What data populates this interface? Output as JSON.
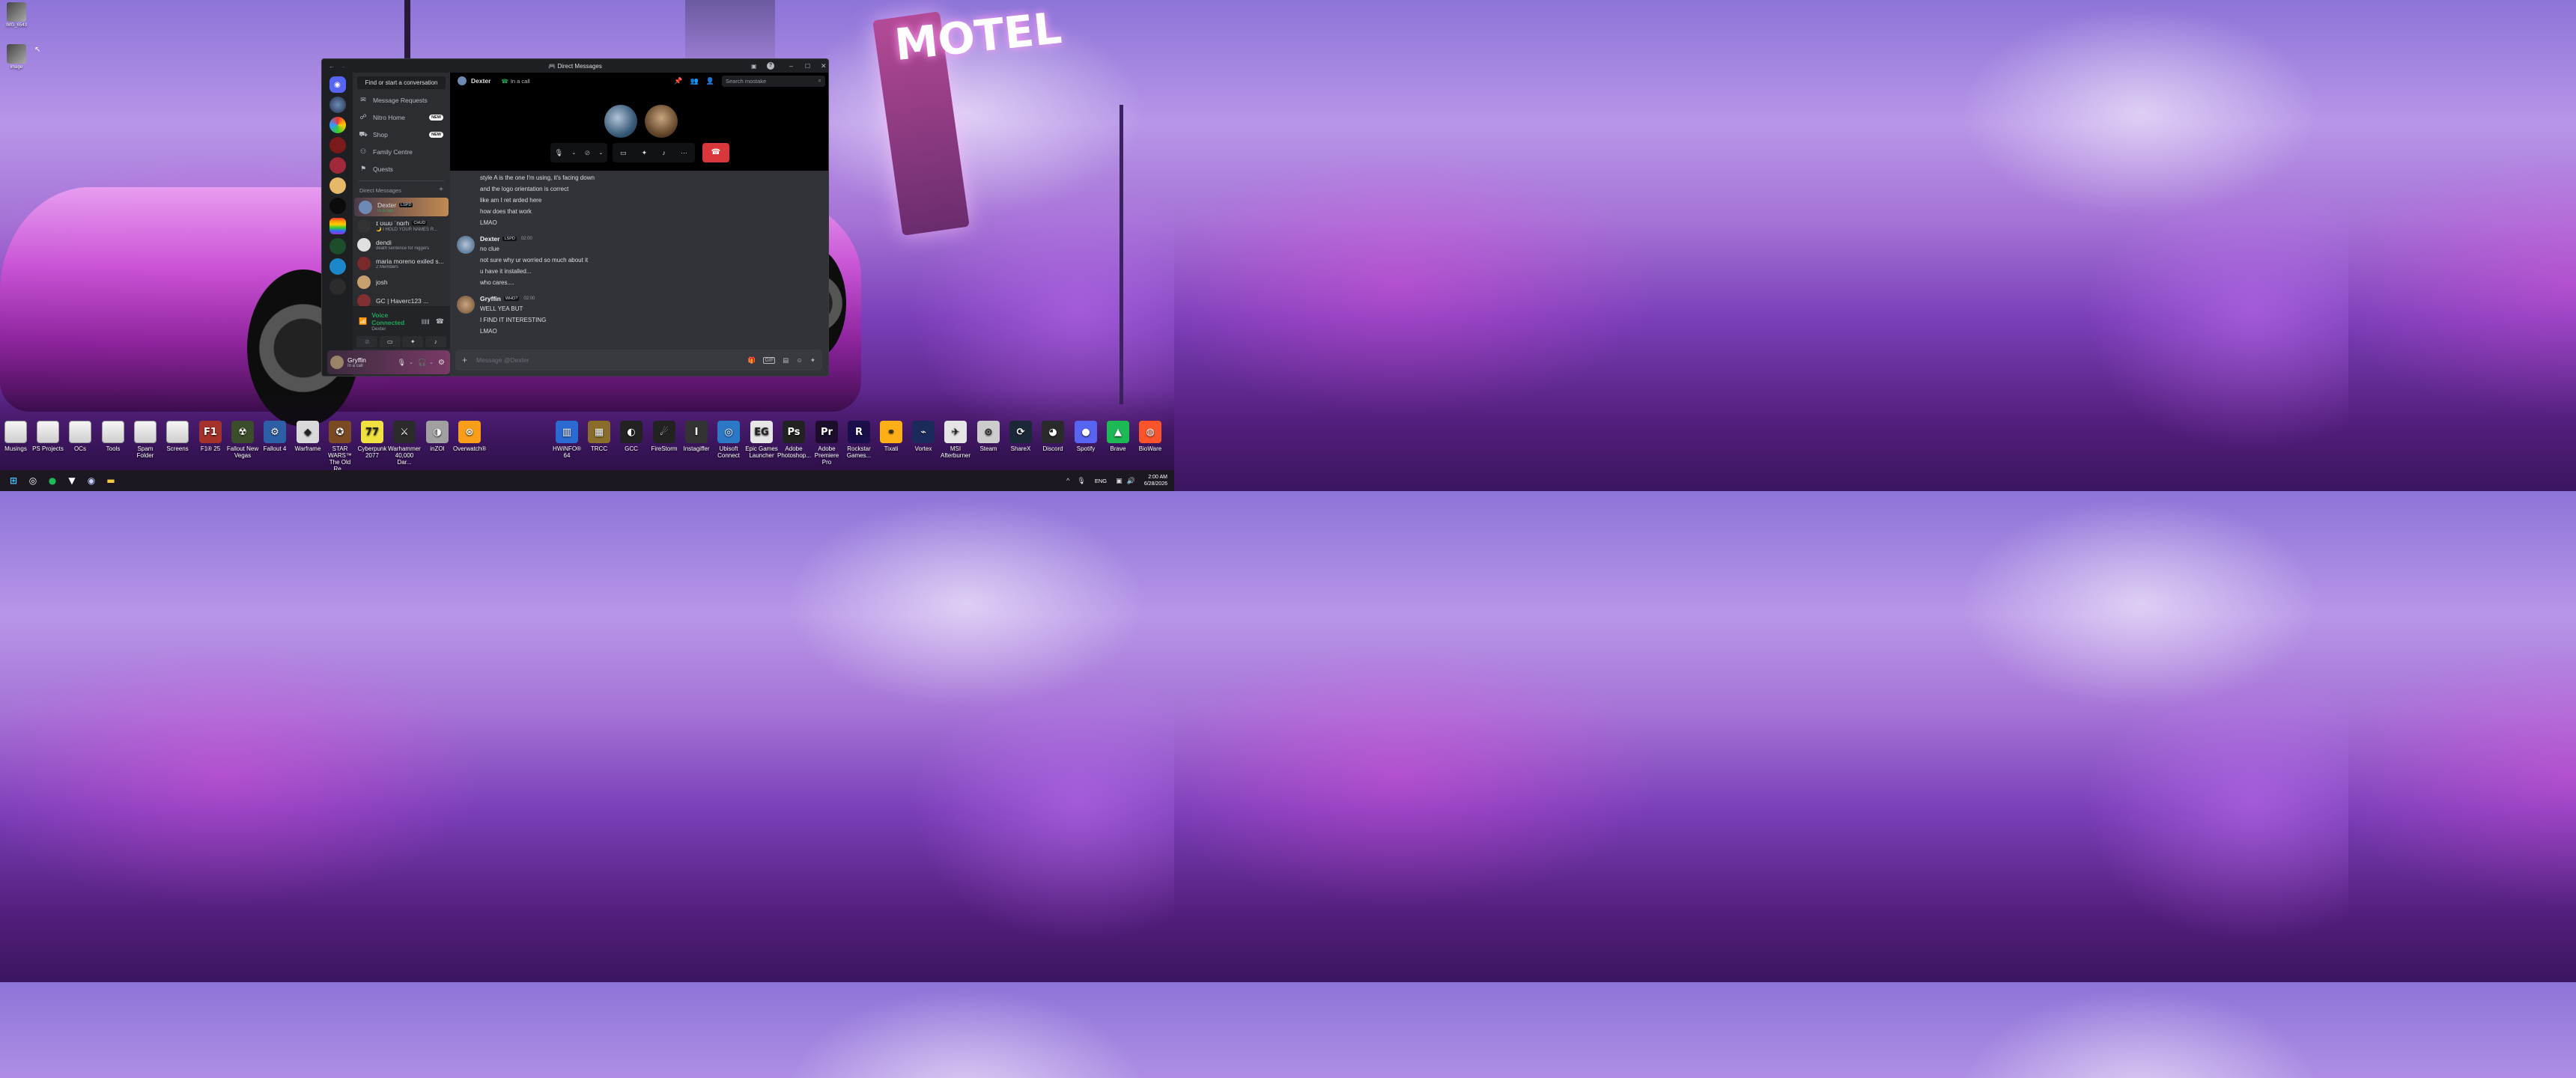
{
  "desktop_icons_top": [
    {
      "label": "IMG_6543"
    },
    {
      "label": "image"
    }
  ],
  "dock": {
    "left": [
      "Musings",
      "PS Projects",
      "OCs",
      "Tools",
      "Spam Folder",
      "Screens",
      "F1® 25",
      "Fallout New Vegas",
      "Fallout 4",
      "Warframe",
      "STAR WARS™ The Old Re...",
      "Cyberpunk 2077",
      "Warhammer 40,000 Dar...",
      "inZOI",
      "Overwatch®"
    ],
    "right": [
      "HWiNFO® 64",
      "TRCC",
      "GCC",
      "FireStorm",
      "Instagiffer",
      "Ubisoft Connect",
      "Epic Games Launcher",
      "Adobe Photoshop...",
      "Adobe Premiere Pro",
      "Rockstar Games...",
      "Tixati",
      "Vortex",
      "MSI Afterburner",
      "Steam",
      "ShareX",
      "Discord",
      "Spotify",
      "Brave",
      "BioWare"
    ]
  },
  "wallpaper": {
    "sign_text": "MOTEL"
  },
  "discord": {
    "title": "Direct Messages",
    "find": "Find or start a conversation",
    "nav": [
      {
        "label": "Message Requests",
        "icon": "mail-icon",
        "badge": ""
      },
      {
        "label": "Nitro Home",
        "icon": "nitro-icon",
        "badge": "NEW"
      },
      {
        "label": "Shop",
        "icon": "shop-icon",
        "badge": "NEW"
      },
      {
        "label": "Family Centre",
        "icon": "family-icon",
        "badge": ""
      },
      {
        "label": "Quests",
        "icon": "quests-icon",
        "badge": ""
      }
    ],
    "dm_header": "Direct Messages",
    "dms": [
      {
        "name": "Dexter",
        "tag": "LSPD",
        "sub": "In a call"
      },
      {
        "name": "ɪ ʊɯʊ ˈnɑɾh",
        "tag": "CHUD",
        "sub": "🌙 I HOLD YOUR NAMES R..."
      },
      {
        "name": "dendi",
        "tag": "",
        "sub": "death sentence for niggers"
      },
      {
        "name": "maria moreno exiled s...",
        "tag": "",
        "sub": "2 Members"
      },
      {
        "name": "josh",
        "tag": "",
        "sub": ""
      },
      {
        "name": "GC | Haverc123 ...",
        "tag": "",
        "sub": ""
      }
    ],
    "voice": {
      "status": "Voice Connected",
      "channel": "Dexter"
    },
    "user": {
      "name": "Gryffin",
      "status": "In a call"
    },
    "chat_header": {
      "name": "Dexter",
      "status": "In a call",
      "search_placeholder": "Search mostake"
    },
    "messages_first": [
      "style A is the one I'm using, it's facing down",
      "and the logo orientation is correct",
      "like am I ret arded here",
      "how does that work",
      "LMAO"
    ],
    "message_groups": [
      {
        "author": "Dexter",
        "tag": "LSPD",
        "time": "02:00",
        "lines": [
          "no clue",
          "not sure why ur worried so much about it",
          "u have it installed...",
          "who cares...."
        ]
      },
      {
        "author": "Gryffin",
        "tag": "WHO?",
        "time": "02:00",
        "lines": [
          "WELL YEA BUT",
          "I FIND IT INTERESTING",
          "LMAO"
        ]
      }
    ],
    "composer_placeholder": "Message @Dexter",
    "colors": {
      "accent": "#5865f2",
      "hangup": "#da373c",
      "online": "#23a55a"
    }
  },
  "system_tray": {
    "lang": "ENG",
    "time": "2:00 AM",
    "date": "6/28/2026"
  }
}
